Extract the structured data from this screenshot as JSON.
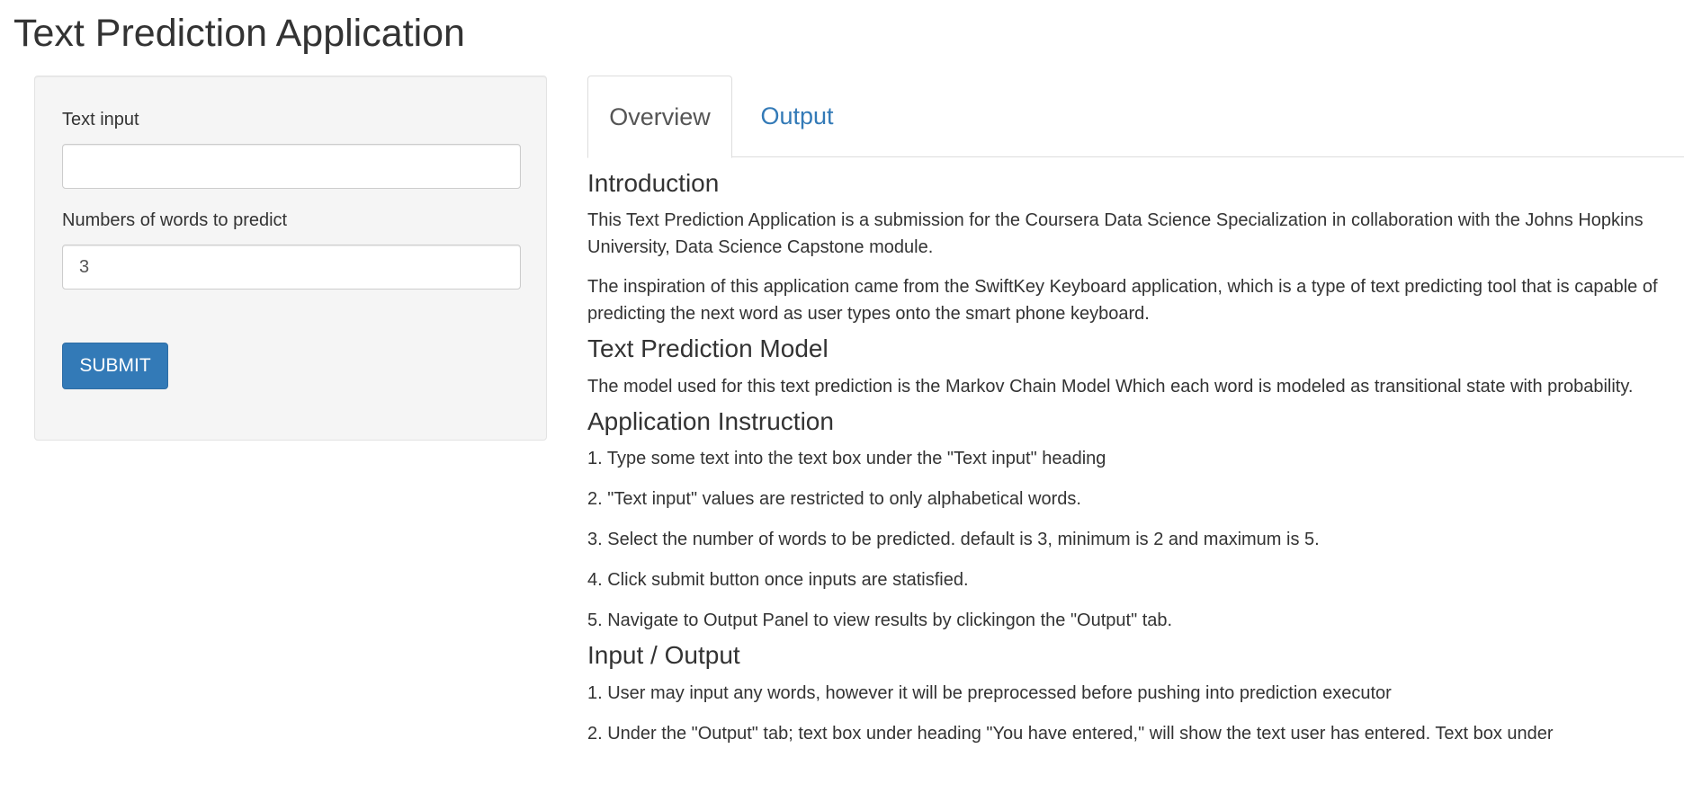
{
  "app_title": "Text Prediction Application",
  "sidebar": {
    "text_input_label": "Text input",
    "text_input_value": "",
    "words_label": "Numbers of words to predict",
    "words_value": "3",
    "submit_label": "SUBMIT"
  },
  "tabs": [
    {
      "label": "Overview",
      "active": true
    },
    {
      "label": "Output",
      "active": false
    }
  ],
  "overview": {
    "intro_heading": "Introduction",
    "intro_p1": "This Text Prediction Application is a submission for the Coursera Data Science Specialization in collaboration with the Johns Hopkins University, Data Science Capstone module.",
    "intro_p2": "The inspiration of this application came from the SwiftKey Keyboard application, which is a type of text predicting tool that is capable of predicting the next word as user types onto the smart phone keyboard.",
    "model_heading": "Text Prediction Model",
    "model_p1": "The model used for this text prediction is the Markov Chain Model Which each word is modeled as transitional state with probability.",
    "instruction_heading": "Application Instruction",
    "instructions": [
      "1. Type some text into the text box under the \"Text input\" heading",
      "2. \"Text input\" values are restricted to only alphabetical words.",
      "3. Select the number of words to be predicted. default is 3, minimum is 2 and maximum is 5.",
      "4. Click submit button once inputs are statisfied.",
      "5. Navigate to Output Panel to view results by clickingon the \"Output\" tab."
    ],
    "io_heading": "Input / Output",
    "io_items": [
      "1. User may input any words, however it will be preprocessed before pushing into prediction executor",
      "2. Under the \"Output\" tab; text box under heading \"You have entered,\" will show the text user has entered. Text box under"
    ]
  }
}
